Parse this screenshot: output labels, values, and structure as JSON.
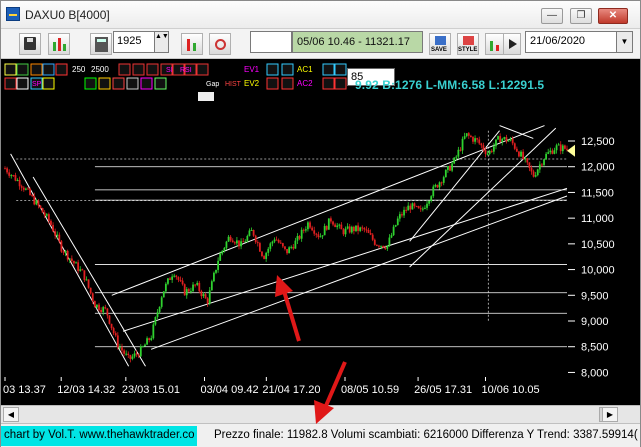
{
  "window": {
    "title": "DAXU0 B[4000]",
    "min_label": "—",
    "max_label": "❐",
    "close_label": "✕"
  },
  "toolbar": {
    "period_value": "1925",
    "period_spin": "▲▼",
    "datetime_text": "05/06 10.46 - 11321.17",
    "date_value": "21/06/2020",
    "date_drop": "▼",
    "save_label": "SAVE",
    "style_label": "STYLE"
  },
  "indicator_bar": {
    "row1_labels": [
      "250",
      "2500"
    ],
    "hr_label": "HR",
    "ev1": "EV1",
    "ev2": "EV2",
    "ac1": "AC1",
    "ac2": "AC2",
    "gap": "Gap",
    "hist": "HIST",
    "sp": "SP",
    "si": "SI",
    "rsi": "RSI",
    "input_value": "85"
  },
  "info": {
    "text": "9.92 B:1276 L-MM:6.58 L:12291.5"
  },
  "y_axis": {
    "ticks": [
      "12,500",
      "12,000",
      "11,500",
      "11,000",
      "10,500",
      "10,000",
      "9,500",
      "9,000",
      "8,500",
      "8,000"
    ]
  },
  "x_axis": {
    "ticks": [
      "03 13.37",
      "12/03 14.32",
      "23/03 15.01",
      "03/04 09.42",
      "21/04 17.20",
      "08/05 10.59",
      "26/05 17.31",
      "10/06 10.05"
    ]
  },
  "colors": {
    "up": "#2fd22f",
    "down": "#e02020",
    "channel": "#ffffff",
    "arrow": "#e01818",
    "info": "#39d0d0",
    "credit_bg": "#00e5e5"
  },
  "chart_data": {
    "type": "candlestick",
    "ylim": [
      7950,
      12850
    ],
    "yticks": [
      12500,
      12000,
      11500,
      11000,
      10500,
      10000,
      9500,
      9000,
      8500,
      8000
    ],
    "x": [
      "03 13.37",
      "12/03 14.32",
      "23/03 15.01",
      "03/04 09.42",
      "21/04 17.20",
      "08/05 10.59",
      "26/05 17.31",
      "10/06 10.05"
    ],
    "close_path": [
      [
        0,
        11970
      ],
      [
        0.03,
        11650
      ],
      [
        0.06,
        11220
      ],
      [
        0.08,
        10920
      ],
      [
        0.1,
        10430
      ],
      [
        0.12,
        10160
      ],
      [
        0.14,
        9900
      ],
      [
        0.16,
        9320
      ],
      [
        0.18,
        9200
      ],
      [
        0.2,
        8560
      ],
      [
        0.22,
        8250
      ],
      [
        0.24,
        8400
      ],
      [
        0.26,
        8700
      ],
      [
        0.28,
        9550
      ],
      [
        0.3,
        9980
      ],
      [
        0.32,
        9560
      ],
      [
        0.34,
        9700
      ],
      [
        0.36,
        9370
      ],
      [
        0.38,
        10230
      ],
      [
        0.4,
        10660
      ],
      [
        0.42,
        10470
      ],
      [
        0.44,
        10760
      ],
      [
        0.46,
        10250
      ],
      [
        0.48,
        10630
      ],
      [
        0.5,
        10330
      ],
      [
        0.52,
        10570
      ],
      [
        0.54,
        10920
      ],
      [
        0.56,
        10640
      ],
      [
        0.58,
        10980
      ],
      [
        0.6,
        10740
      ],
      [
        0.62,
        10790
      ],
      [
        0.64,
        10770
      ],
      [
        0.66,
        10510
      ],
      [
        0.68,
        10460
      ],
      [
        0.7,
        11000
      ],
      [
        0.72,
        11240
      ],
      [
        0.74,
        11120
      ],
      [
        0.76,
        11520
      ],
      [
        0.78,
        11810
      ],
      [
        0.8,
        12120
      ],
      [
        0.82,
        12620
      ],
      [
        0.84,
        12500
      ],
      [
        0.86,
        12250
      ],
      [
        0.88,
        12560
      ],
      [
        0.9,
        12500
      ],
      [
        0.92,
        12190
      ],
      [
        0.94,
        11820
      ],
      [
        0.96,
        12200
      ],
      [
        0.98,
        12380
      ],
      [
        1.0,
        12350
      ]
    ],
    "horizontal_levels": [
      12000,
      11550,
      11350,
      10100,
      9550,
      9150,
      8500
    ],
    "dotted_levels": [
      12150,
      11340
    ],
    "last_price": 12310
  },
  "status": {
    "credit": "chart by Vol.T. www.thehawktrader.co",
    "text": "Prezzo finale: 11982.8 Volumi scambiati: 6216000 Differenza Y Trend: 3387.59914("
  }
}
